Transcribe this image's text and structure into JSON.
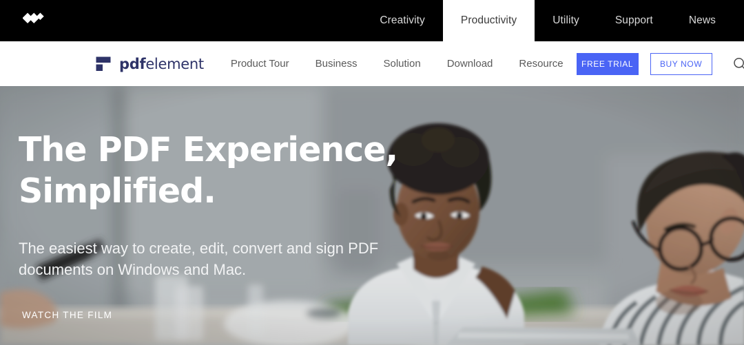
{
  "topbar": {
    "brand_logo_name": "wondershare-logo",
    "nav": [
      {
        "label": "Creativity",
        "active": false
      },
      {
        "label": "Productivity",
        "active": true
      },
      {
        "label": "Utility",
        "active": false
      },
      {
        "label": "Support",
        "active": false
      },
      {
        "label": "News",
        "active": false
      }
    ]
  },
  "subnav": {
    "logo": {
      "bold": "pdf",
      "light": "element",
      "color": "#2e3368"
    },
    "links": [
      {
        "label": "Product Tour"
      },
      {
        "label": "Business"
      },
      {
        "label": "Solution"
      },
      {
        "label": "Download"
      },
      {
        "label": "Resource"
      }
    ],
    "free_trial_label": "FREE TRIAL",
    "buy_now_label": "BUY NOW",
    "search_icon": "search-icon",
    "accent_color": "#4a64f5"
  },
  "hero": {
    "heading_line1": "The PDF Experience,",
    "heading_line2": "Simplified.",
    "subheading_line1": "The easiest way to create, edit, convert and sign PDF",
    "subheading_line2": "documents on Windows and Mac.",
    "watch_film_label": "WATCH THE FILM",
    "photo_description": "Two colleagues looking at a laptop in a bright office"
  }
}
